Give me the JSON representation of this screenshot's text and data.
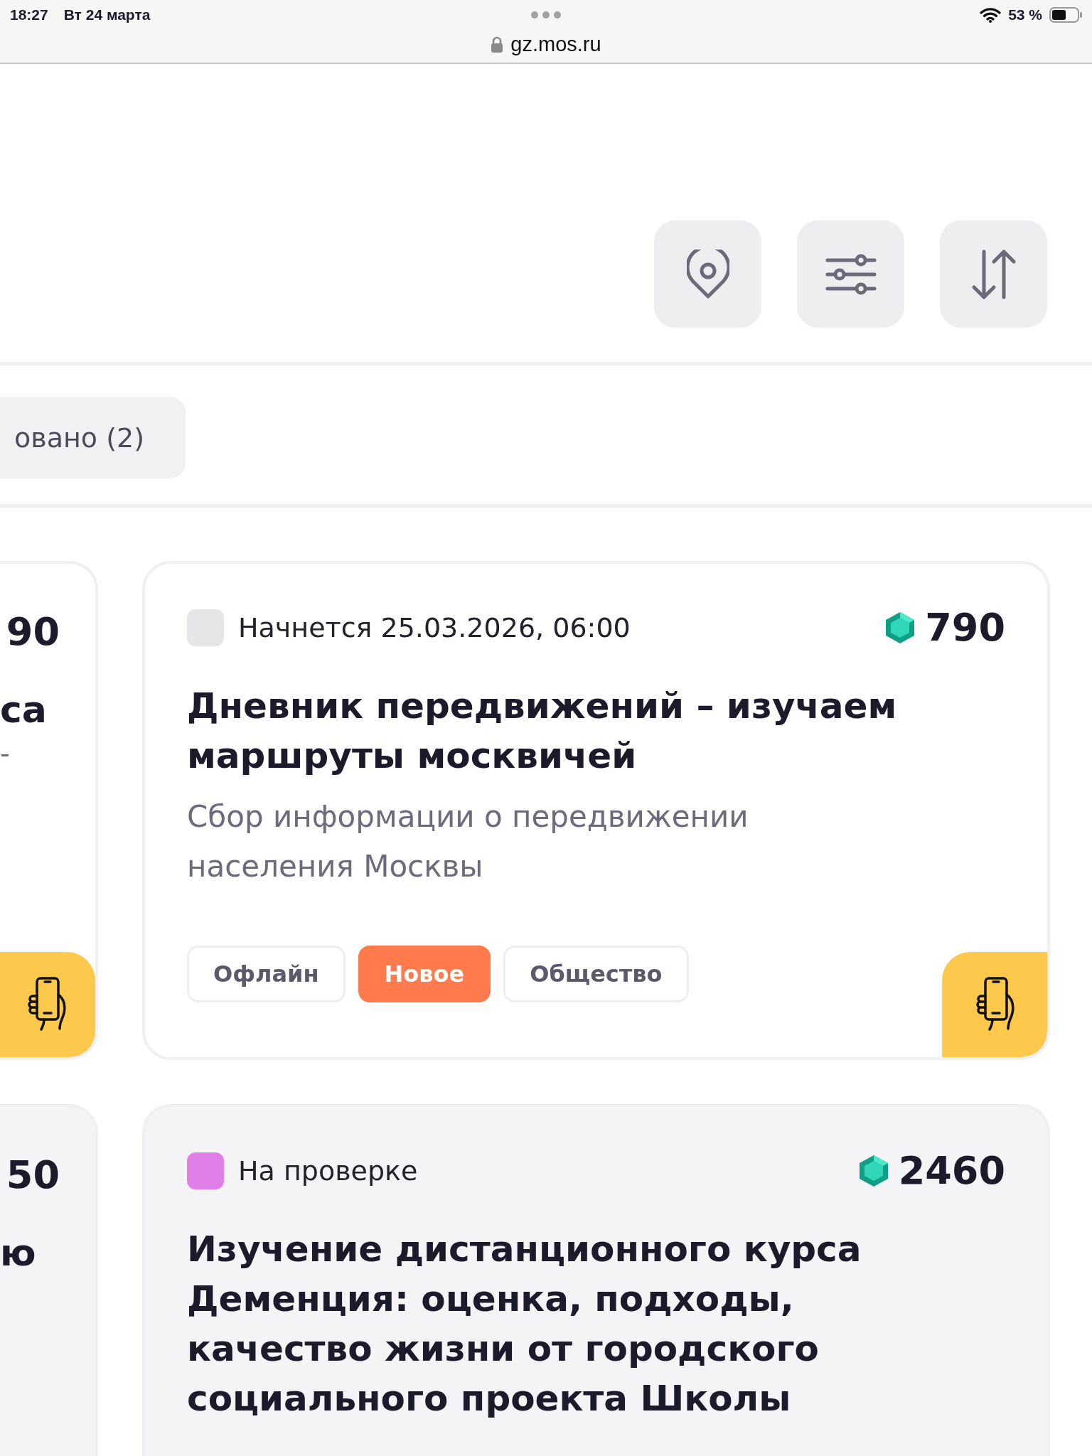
{
  "status_bar": {
    "time": "18:27",
    "date": "Вт 24 марта",
    "battery": "53 %",
    "url": "gz.mos.ru"
  },
  "filter_tab": {
    "label": "овано (2)"
  },
  "left_cards": [
    {
      "points": "90",
      "title": "са",
      "note": "-",
      "kind": "offline"
    },
    {
      "points": "50",
      "title": "ю",
      "kind": "review"
    }
  ],
  "cards": [
    {
      "kind": "upcoming",
      "status": {
        "label": "Начнется 25.03.2026, 06:00",
        "color": "#e6e6e8"
      },
      "points": "790",
      "title": "Дневник передвижений – изучаем маршруты москвичей",
      "description": "Сбор информации о передвижении населения Москвы",
      "tags": [
        {
          "label": "Офлайн",
          "kind": "plain"
        },
        {
          "label": "Новое",
          "kind": "new"
        },
        {
          "label": "Общество",
          "kind": "plain"
        }
      ]
    },
    {
      "kind": "review",
      "status": {
        "label": "На проверке",
        "color": "#e07ee8"
      },
      "points": "2460",
      "title": "Изучение дистанционного курса Деменция: оценка, подходы, качество жизни от городского социального проекта Школы"
    }
  ]
}
